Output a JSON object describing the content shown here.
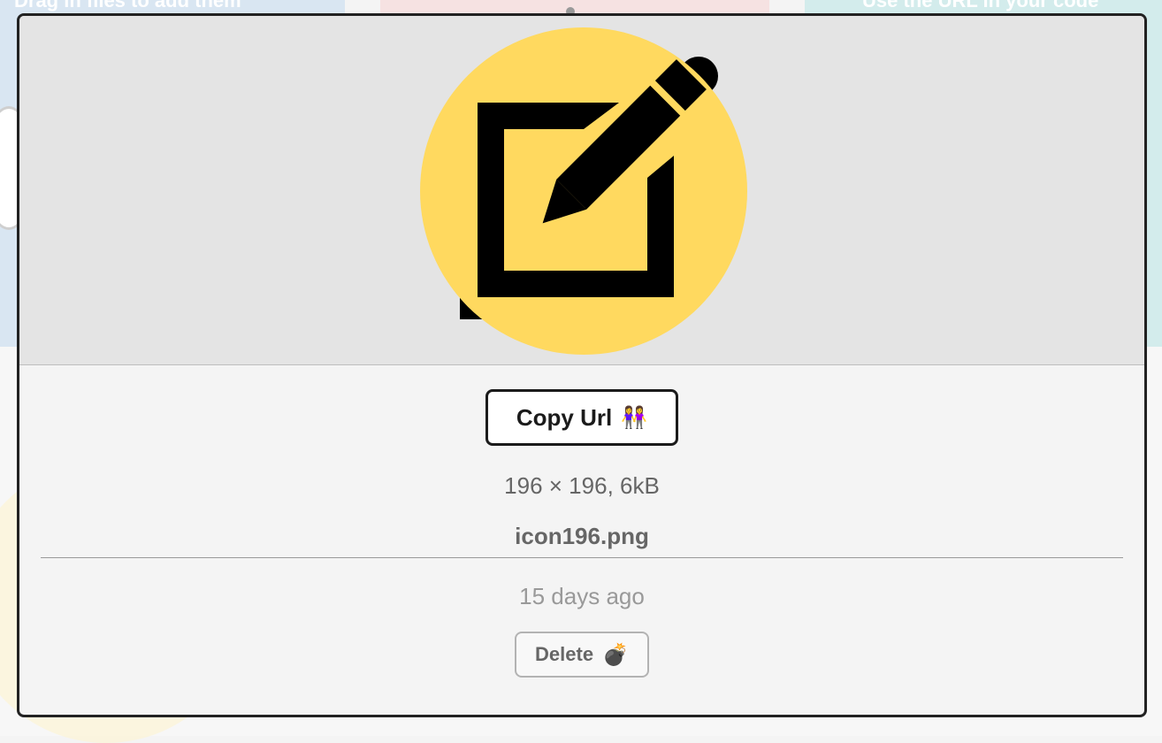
{
  "background": {
    "left_heading": "Drag in files to add them",
    "right_heading": "Use the URL in your code"
  },
  "modal": {
    "preview_icon": "edit-note-icon",
    "colors": {
      "icon_circle": "#FFD95F",
      "icon_stroke": "#000000",
      "preview_bg": "#E4E4E4"
    },
    "copy_button": {
      "label": "Copy Url",
      "emoji": "👭"
    },
    "meta": "196 × 196, 6kB",
    "filename": "icon196.png",
    "age": "15 days ago",
    "delete_button": {
      "label": "Delete",
      "emoji": "💣"
    }
  }
}
